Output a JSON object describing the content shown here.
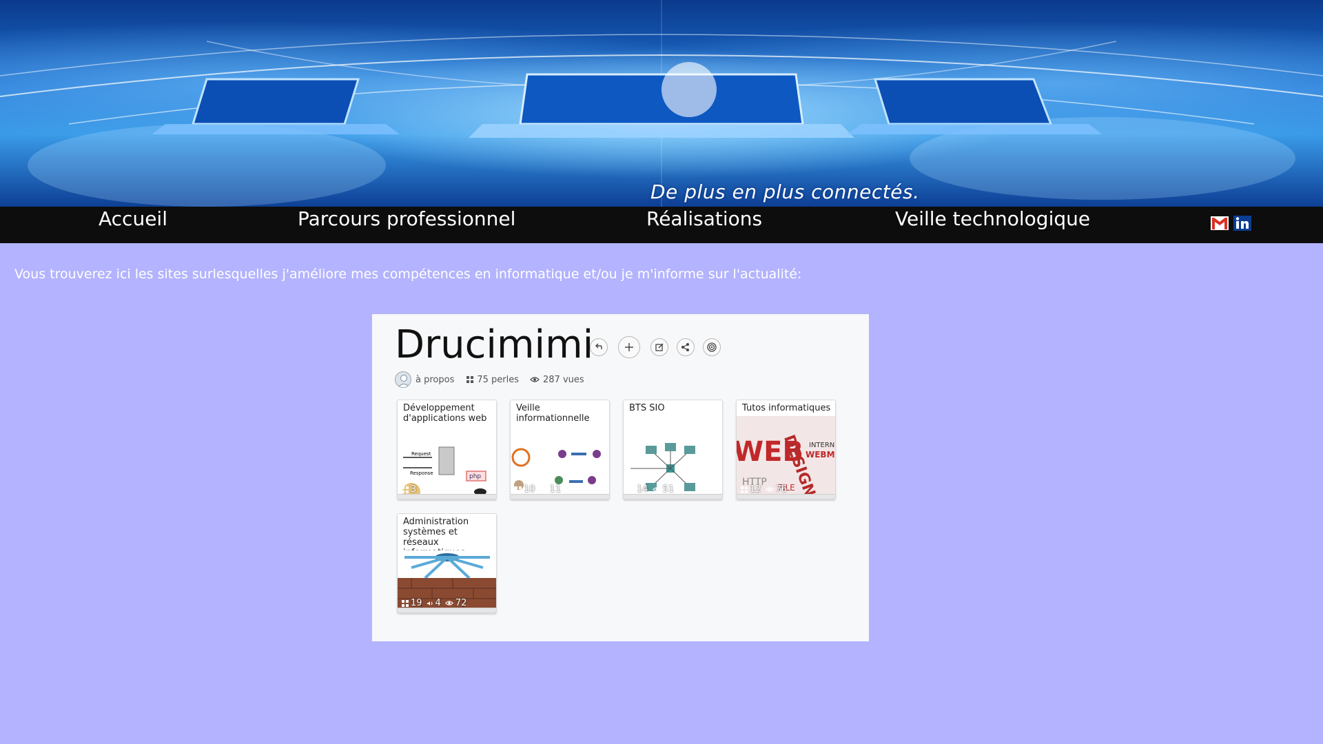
{
  "banner": {
    "tagline": "De plus en plus connectés."
  },
  "nav": {
    "items": [
      {
        "label": "Accueil"
      },
      {
        "label": "Parcours professionnel"
      },
      {
        "label": "Réalisations"
      },
      {
        "label": "Veille technologique"
      }
    ],
    "social": [
      {
        "icon": "gmail-icon",
        "color": "#d93025"
      },
      {
        "icon": "linkedin-icon",
        "color": "#0a66c2"
      }
    ]
  },
  "intro": "Vous trouverez ici les sites surlesquelles j'améliore mes compétences en informatique et/ou je m'informe sur l'actualité:",
  "widget": {
    "title": "Drucimimi",
    "buttons": [
      "back-icon",
      "plus-icon",
      "edit-icon",
      "share-icon",
      "target-icon"
    ],
    "about": "à propos",
    "pearls": "75 perles",
    "views": "287 vues",
    "cards": [
      {
        "title": "Développement d'applications web",
        "stats": [
          "3"
        ]
      },
      {
        "title": "Veille informationnelle",
        "stats": [
          "10",
          "11"
        ]
      },
      {
        "title": "BTS SIO",
        "stats": [
          "14",
          "51"
        ]
      },
      {
        "title": "Tutos informatiques",
        "stats": [
          "12",
          "76"
        ]
      },
      {
        "title": "Administration systèmes et réseaux informatiques",
        "stats": [
          "19",
          "4",
          "72"
        ]
      }
    ]
  },
  "colors": {
    "page_background": "#b3b3ff",
    "nav_background": "#0d0d0d",
    "widget_background": "#f7f8fa"
  }
}
